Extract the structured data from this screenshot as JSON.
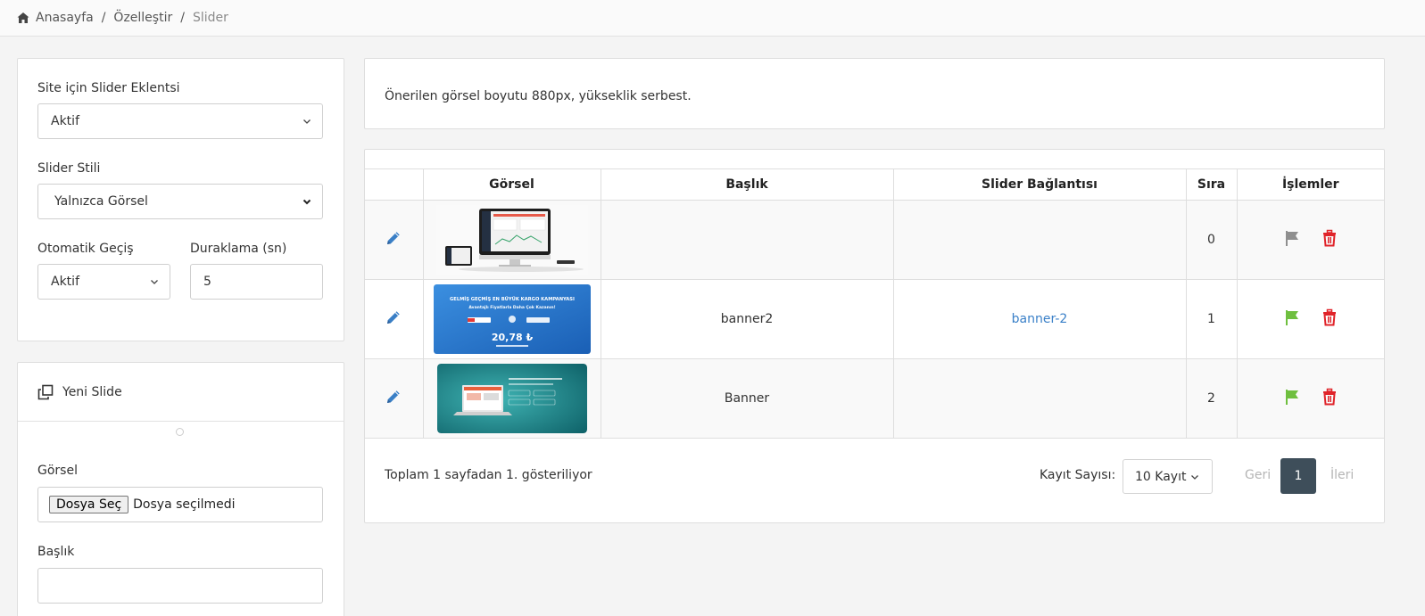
{
  "breadcrumb": {
    "home": "Anasayfa",
    "sep": "/",
    "customize": "Özelleştir",
    "current": "Slider"
  },
  "settings": {
    "plugin_label": "Site için Slider Eklentsi",
    "plugin_value": "Aktif",
    "style_label": "Slider Stili",
    "style_value": "Yalnızca Görsel",
    "auto_label": "Otomatik Geçiş",
    "auto_value": "Aktif",
    "pause_label": "Duraklama (sn)",
    "pause_value": "5"
  },
  "new_slide": {
    "title": "Yeni Slide",
    "image_label": "Görsel",
    "file_button": "Dosya Seç",
    "file_status": "Dosya seçilmedi",
    "title_label": "Başlık",
    "title_value": ""
  },
  "info": {
    "text": "Önerilen görsel boyutu 880px, yükseklik serbest."
  },
  "table": {
    "headers": [
      "",
      "Görsel",
      "Başlık",
      "Slider Bağlantısı",
      "Sıra",
      "İşlemler"
    ],
    "rows": [
      {
        "title": "",
        "link": "",
        "order": "0",
        "flag_color": "#8f8f8f"
      },
      {
        "title": "banner2",
        "link": "banner-2",
        "order": "1",
        "flag_color": "#6fbf3f"
      },
      {
        "title": "Banner",
        "link": "",
        "order": "2",
        "flag_color": "#6fbf3f"
      }
    ],
    "thumb2": {
      "headline": "GELMİŞ GEÇMİŞ EN BÜYÜK KARGO KAMPANYASI",
      "sub": "Avantajlı Fiyatlarla Daha Çok Kazanın!",
      "price": "20,78 ₺"
    }
  },
  "footer": {
    "summary": "Toplam 1 sayfadan 1. gösteriliyor",
    "per_page_label": "Kayıt Sayısı:",
    "per_page_value": "10 Kayıt",
    "prev": "Geri",
    "current_page": "1",
    "next": "İleri"
  },
  "colors": {
    "accent_blue": "#3a80c8",
    "delete_red": "#e0242a",
    "page_active": "#3e4e5a"
  }
}
